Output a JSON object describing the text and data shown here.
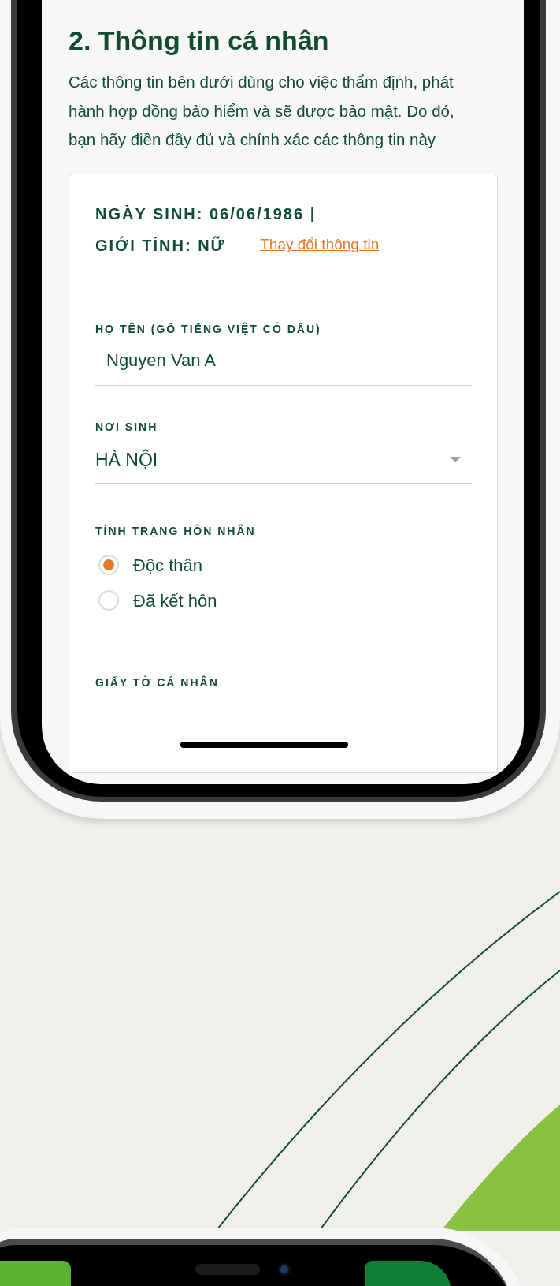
{
  "section": {
    "title": "2. Thông tin cá nhân",
    "description": "Các thông tin bên dưới dùng cho việc thẩm định, phát hành hợp đồng bảo hiểm và sẽ được bảo mật. Do đó, bạn hãy điền đầy đủ và chính xác các thông tin này"
  },
  "summary": {
    "birth_date": "NGÀY SINH: 06/06/1986 |",
    "gender": "GIỚI TÍNH: NỮ",
    "change_link": "Thay đổi thông tin"
  },
  "full_name": {
    "label": "HỌ TÊN (GÕ TIẾNG VIỆT CÓ DẤU)",
    "value": "Nguyen Van A"
  },
  "birthplace": {
    "label": "NƠI SINH",
    "value": "HÀ NỘI"
  },
  "marital_status": {
    "label": "TÌNH TRẠNG HÔN NHÂN",
    "options": [
      {
        "label": "Độc thân",
        "selected": true
      },
      {
        "label": "Đã kết hôn",
        "selected": false
      }
    ]
  },
  "id_documents": {
    "label": "GIẤY TỜ CÁ NHÂN"
  }
}
